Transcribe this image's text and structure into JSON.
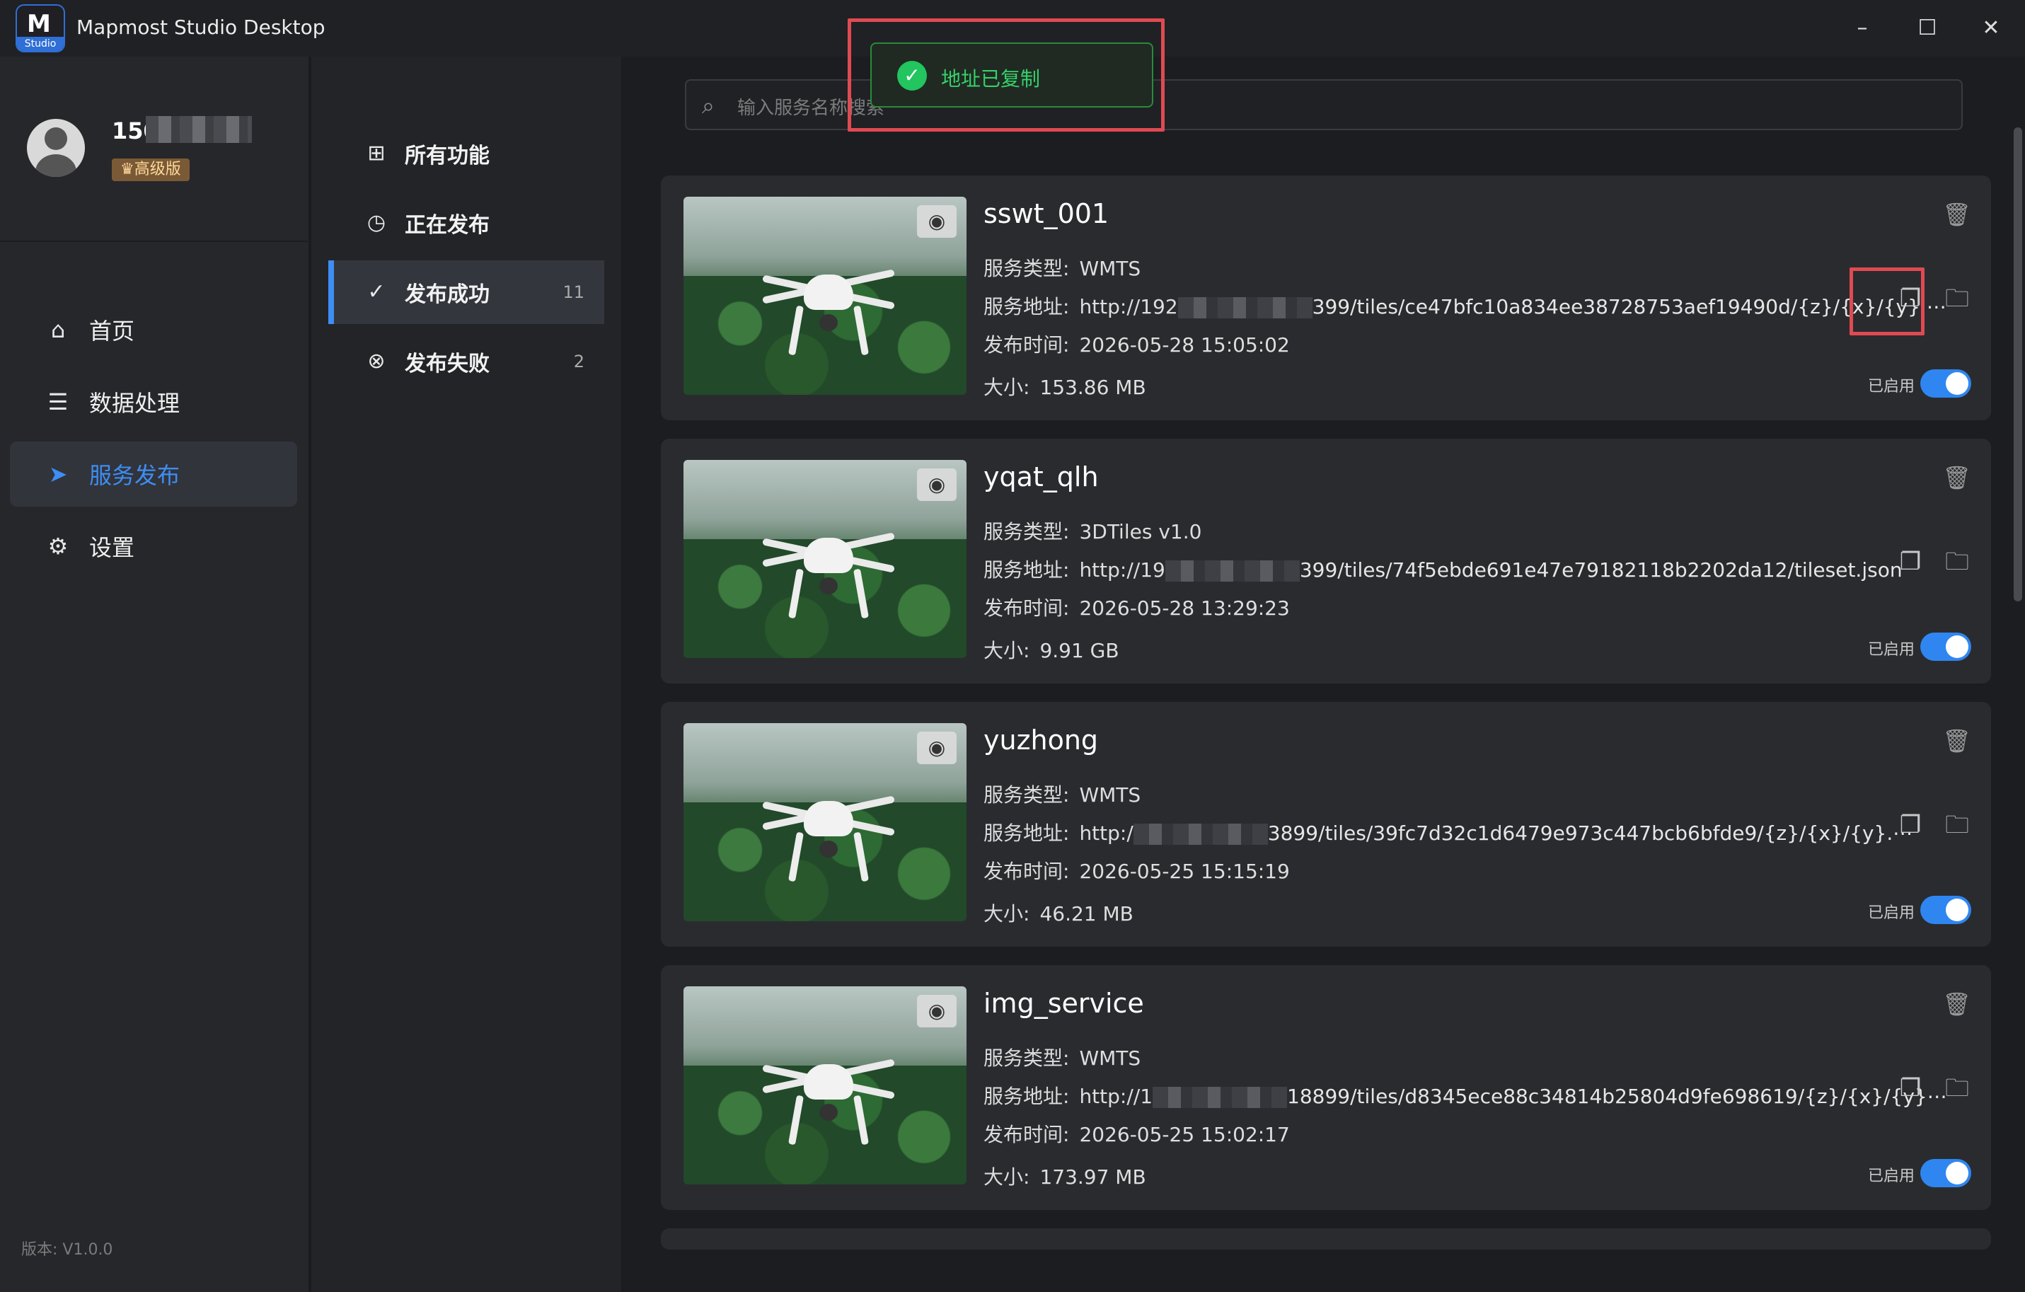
{
  "window": {
    "title": "Mapmost Studio Desktop",
    "logo_letter": "M",
    "logo_sub": "Studio"
  },
  "user": {
    "name": "150",
    "badge": "♛高级版"
  },
  "nav": {
    "items": [
      {
        "label": "首页",
        "icon": "home-icon"
      },
      {
        "label": "数据处理",
        "icon": "database-icon"
      },
      {
        "label": "服务发布",
        "icon": "send-icon",
        "active": true
      },
      {
        "label": "设置",
        "icon": "gear-icon"
      }
    ]
  },
  "version": "版本: V1.0.0",
  "subnav": {
    "items": [
      {
        "label": "所有功能",
        "icon": "grid-icon"
      },
      {
        "label": "正在发布",
        "icon": "clock-icon"
      },
      {
        "label": "发布成功",
        "icon": "check-circle-icon",
        "count": "11",
        "active": true
      },
      {
        "label": "发布失败",
        "icon": "x-circle-icon",
        "count": "2"
      }
    ]
  },
  "search": {
    "placeholder": "输入服务名称搜索"
  },
  "toast": {
    "text": "地址已复制"
  },
  "labels": {
    "type": "服务类型:",
    "url": "服务地址:",
    "time": "发布时间:",
    "size": "大小:",
    "enabled": "已启用"
  },
  "services": [
    {
      "name": "sswt_001",
      "type": "WMTS",
      "url_start": "http://192",
      "url_end": "399/tiles/ce47bfc10a834ee38728753aef19490d/{z}/{x}/{y}.⋯",
      "time": "2026-05-28 15:05:02",
      "size": "153.86 MB"
    },
    {
      "name": "yqat_qlh",
      "type": "3DTiles v1.0",
      "url_start": "http://19",
      "url_end": "399/tiles/74f5ebde691e47e79182118b2202da12/tileset.json",
      "time": "2026-05-28 13:29:23",
      "size": "9.91 GB"
    },
    {
      "name": "yuzhong",
      "type": "WMTS",
      "url_start": "http:/",
      "url_end": "3899/tiles/39fc7d32c1d6479e973c447bcb6bfde9/{z}/{x}/{y}.⋯",
      "time": "2026-05-25 15:15:19",
      "size": "46.21 MB"
    },
    {
      "name": "img_service",
      "type": "WMTS",
      "url_start": "http://1",
      "url_end": "18899/tiles/d8345ece88c34814b25804d9fe698619/{z}/{x}/{y}⋯",
      "time": "2026-05-25 15:02:17",
      "size": "173.97 MB"
    }
  ]
}
